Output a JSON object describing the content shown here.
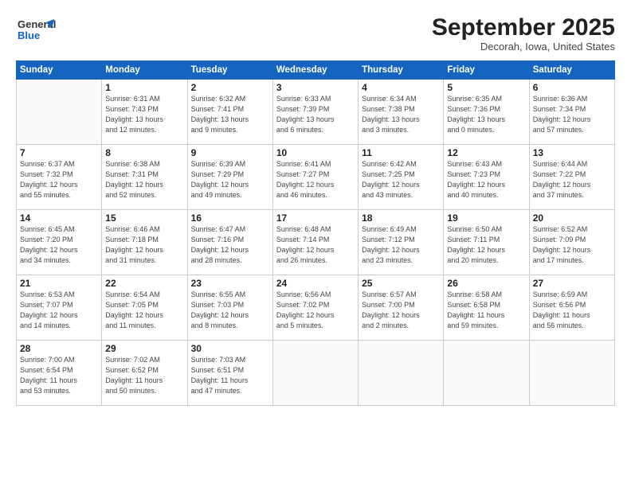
{
  "header": {
    "logo_line1": "General",
    "logo_line2": "Blue",
    "month": "September 2025",
    "location": "Decorah, Iowa, United States"
  },
  "weekdays": [
    "Sunday",
    "Monday",
    "Tuesday",
    "Wednesday",
    "Thursday",
    "Friday",
    "Saturday"
  ],
  "weeks": [
    [
      {
        "num": "",
        "info": ""
      },
      {
        "num": "1",
        "info": "Sunrise: 6:31 AM\nSunset: 7:43 PM\nDaylight: 13 hours\nand 12 minutes."
      },
      {
        "num": "2",
        "info": "Sunrise: 6:32 AM\nSunset: 7:41 PM\nDaylight: 13 hours\nand 9 minutes."
      },
      {
        "num": "3",
        "info": "Sunrise: 6:33 AM\nSunset: 7:39 PM\nDaylight: 13 hours\nand 6 minutes."
      },
      {
        "num": "4",
        "info": "Sunrise: 6:34 AM\nSunset: 7:38 PM\nDaylight: 13 hours\nand 3 minutes."
      },
      {
        "num": "5",
        "info": "Sunrise: 6:35 AM\nSunset: 7:36 PM\nDaylight: 13 hours\nand 0 minutes."
      },
      {
        "num": "6",
        "info": "Sunrise: 6:36 AM\nSunset: 7:34 PM\nDaylight: 12 hours\nand 57 minutes."
      }
    ],
    [
      {
        "num": "7",
        "info": "Sunrise: 6:37 AM\nSunset: 7:32 PM\nDaylight: 12 hours\nand 55 minutes."
      },
      {
        "num": "8",
        "info": "Sunrise: 6:38 AM\nSunset: 7:31 PM\nDaylight: 12 hours\nand 52 minutes."
      },
      {
        "num": "9",
        "info": "Sunrise: 6:39 AM\nSunset: 7:29 PM\nDaylight: 12 hours\nand 49 minutes."
      },
      {
        "num": "10",
        "info": "Sunrise: 6:41 AM\nSunset: 7:27 PM\nDaylight: 12 hours\nand 46 minutes."
      },
      {
        "num": "11",
        "info": "Sunrise: 6:42 AM\nSunset: 7:25 PM\nDaylight: 12 hours\nand 43 minutes."
      },
      {
        "num": "12",
        "info": "Sunrise: 6:43 AM\nSunset: 7:23 PM\nDaylight: 12 hours\nand 40 minutes."
      },
      {
        "num": "13",
        "info": "Sunrise: 6:44 AM\nSunset: 7:22 PM\nDaylight: 12 hours\nand 37 minutes."
      }
    ],
    [
      {
        "num": "14",
        "info": "Sunrise: 6:45 AM\nSunset: 7:20 PM\nDaylight: 12 hours\nand 34 minutes."
      },
      {
        "num": "15",
        "info": "Sunrise: 6:46 AM\nSunset: 7:18 PM\nDaylight: 12 hours\nand 31 minutes."
      },
      {
        "num": "16",
        "info": "Sunrise: 6:47 AM\nSunset: 7:16 PM\nDaylight: 12 hours\nand 28 minutes."
      },
      {
        "num": "17",
        "info": "Sunrise: 6:48 AM\nSunset: 7:14 PM\nDaylight: 12 hours\nand 26 minutes."
      },
      {
        "num": "18",
        "info": "Sunrise: 6:49 AM\nSunset: 7:12 PM\nDaylight: 12 hours\nand 23 minutes."
      },
      {
        "num": "19",
        "info": "Sunrise: 6:50 AM\nSunset: 7:11 PM\nDaylight: 12 hours\nand 20 minutes."
      },
      {
        "num": "20",
        "info": "Sunrise: 6:52 AM\nSunset: 7:09 PM\nDaylight: 12 hours\nand 17 minutes."
      }
    ],
    [
      {
        "num": "21",
        "info": "Sunrise: 6:53 AM\nSunset: 7:07 PM\nDaylight: 12 hours\nand 14 minutes."
      },
      {
        "num": "22",
        "info": "Sunrise: 6:54 AM\nSunset: 7:05 PM\nDaylight: 12 hours\nand 11 minutes."
      },
      {
        "num": "23",
        "info": "Sunrise: 6:55 AM\nSunset: 7:03 PM\nDaylight: 12 hours\nand 8 minutes."
      },
      {
        "num": "24",
        "info": "Sunrise: 6:56 AM\nSunset: 7:02 PM\nDaylight: 12 hours\nand 5 minutes."
      },
      {
        "num": "25",
        "info": "Sunrise: 6:57 AM\nSunset: 7:00 PM\nDaylight: 12 hours\nand 2 minutes."
      },
      {
        "num": "26",
        "info": "Sunrise: 6:58 AM\nSunset: 6:58 PM\nDaylight: 11 hours\nand 59 minutes."
      },
      {
        "num": "27",
        "info": "Sunrise: 6:59 AM\nSunset: 6:56 PM\nDaylight: 11 hours\nand 56 minutes."
      }
    ],
    [
      {
        "num": "28",
        "info": "Sunrise: 7:00 AM\nSunset: 6:54 PM\nDaylight: 11 hours\nand 53 minutes."
      },
      {
        "num": "29",
        "info": "Sunrise: 7:02 AM\nSunset: 6:52 PM\nDaylight: 11 hours\nand 50 minutes."
      },
      {
        "num": "30",
        "info": "Sunrise: 7:03 AM\nSunset: 6:51 PM\nDaylight: 11 hours\nand 47 minutes."
      },
      {
        "num": "",
        "info": ""
      },
      {
        "num": "",
        "info": ""
      },
      {
        "num": "",
        "info": ""
      },
      {
        "num": "",
        "info": ""
      }
    ]
  ]
}
